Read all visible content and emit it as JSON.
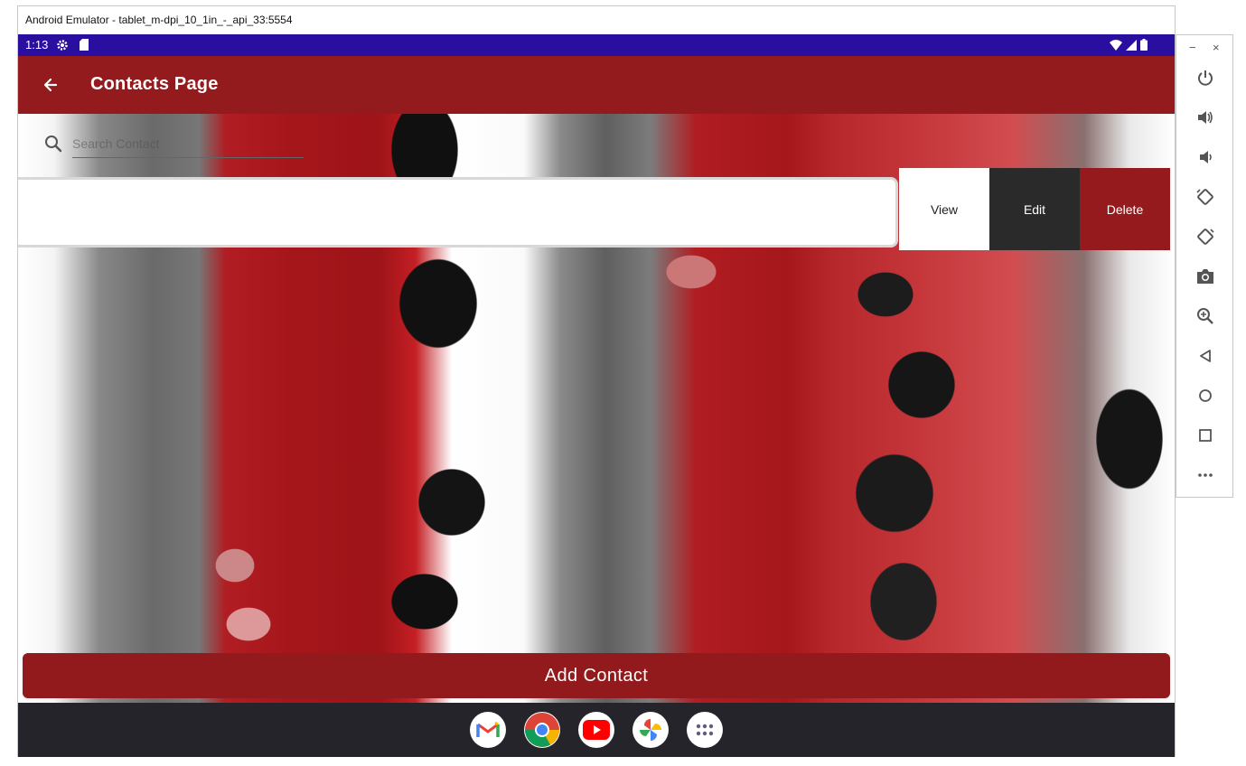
{
  "window": {
    "title": "Android Emulator - tablet_m-dpi_10_1in_-_api_33:5554"
  },
  "status_bar": {
    "time": "1:13",
    "icons": [
      "gear-icon",
      "sdcard-icon",
      "wifi-icon",
      "signal-icon",
      "battery-icon"
    ],
    "color": "#2a0ea0"
  },
  "app_bar": {
    "title": "Contacts Page",
    "back_icon": "arrow-left-icon",
    "color": "#931a1d"
  },
  "search": {
    "placeholder": "Search Contact",
    "value": ""
  },
  "contact_actions": {
    "view": "View",
    "edit": "Edit",
    "delete": "Delete"
  },
  "add_button": {
    "label": "Add Contact"
  },
  "dock": {
    "apps": [
      "Gmail",
      "Chrome",
      "YouTube",
      "Photos",
      "App drawer"
    ]
  },
  "side_panel": {
    "window_controls": {
      "minimize": "−",
      "close": "×"
    },
    "buttons": [
      "power-icon",
      "volume-up-icon",
      "volume-down-icon",
      "rotate-left-icon",
      "rotate-right-icon",
      "camera-icon",
      "zoom-icon",
      "back-icon",
      "home-icon",
      "overview-icon",
      "more-icon"
    ]
  }
}
